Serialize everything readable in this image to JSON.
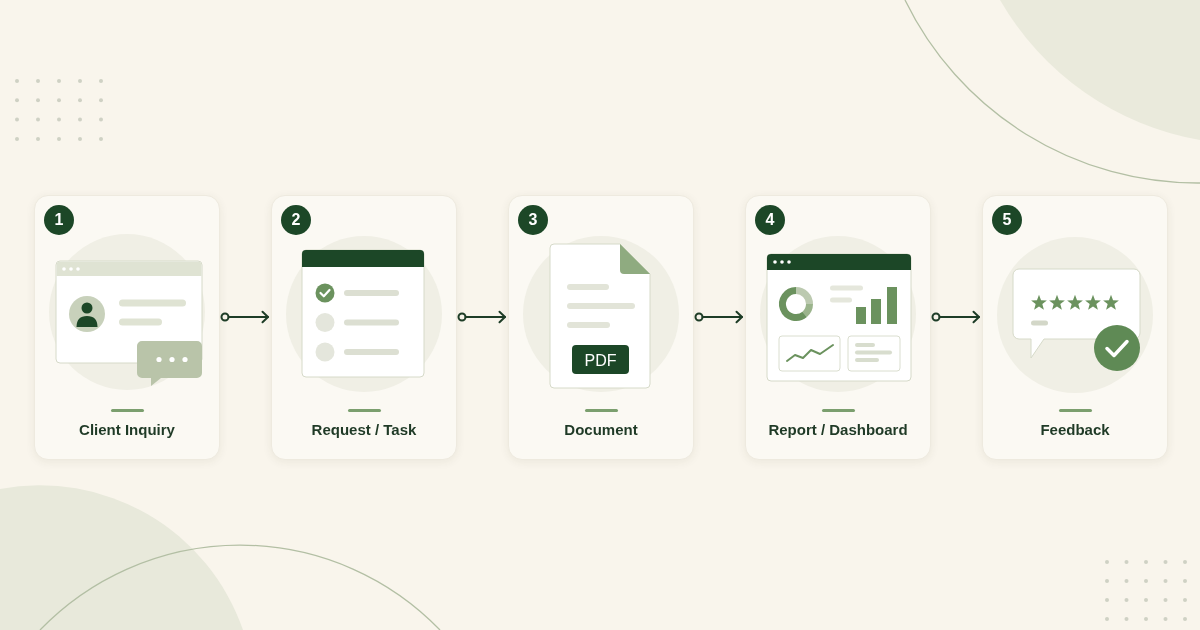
{
  "steps": [
    {
      "number": "1",
      "label": "Client Inquiry",
      "kind": "inquiry"
    },
    {
      "number": "2",
      "label": "Request / Task",
      "kind": "task",
      "tasks": [
        {
          "checked": true
        },
        {
          "checked": false
        },
        {
          "checked": false
        }
      ]
    },
    {
      "number": "3",
      "label": "Document",
      "kind": "document",
      "badge": "PDF"
    },
    {
      "number": "4",
      "label": "Report / Dashboard",
      "kind": "dashboard"
    },
    {
      "number": "5",
      "label": "Feedback",
      "kind": "feedback",
      "stars": 5
    }
  ]
}
